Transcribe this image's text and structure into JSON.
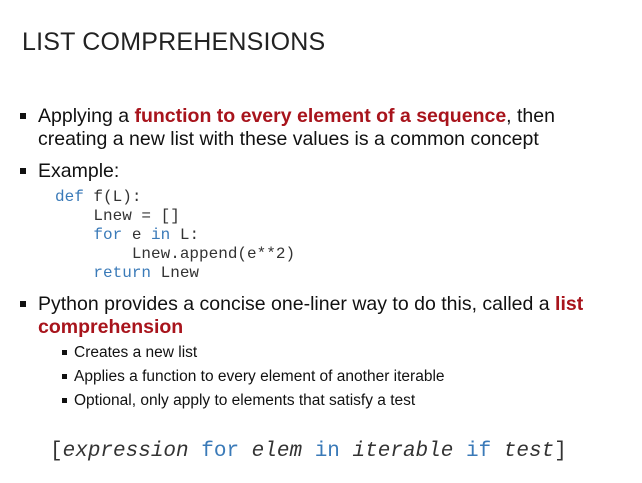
{
  "title": "LIST COMPREHENSIONS",
  "bullet1": {
    "pre": "Applying a ",
    "highlight": "function to every element of a sequence",
    "post": ", then",
    "line2": "creating a new list with these values is a common concept"
  },
  "bullet2": {
    "text": "Example:"
  },
  "code": {
    "l1_kw": "def",
    "l1_rest": " f(L):",
    "l2": "    Lnew = []",
    "l3_kw1": "for",
    "l3_mid": " e ",
    "l3_kw2": "in",
    "l3_rest": " L:",
    "l4": "        Lnew.append(e**2)",
    "l5_kw": "return",
    "l5_rest": " Lnew"
  },
  "bullet3": {
    "pre": "Python provides a concise one-liner way to do this, called a ",
    "highlight1": "list",
    "highlight2": "comprehension"
  },
  "sub_bullets": [
    "Creates a new list",
    "Applies a function to every element of another iterable",
    "Optional, only apply to elements that satisfy a test"
  ],
  "syntax": {
    "open": "[",
    "expression": "expression",
    "for": "for",
    "elem": "elem",
    "in": "in",
    "iterable": "iterable",
    "if": "if",
    "test": "test",
    "close": "]"
  },
  "colors": {
    "highlight": "#a8141c",
    "keyword": "#3a7ab8"
  }
}
